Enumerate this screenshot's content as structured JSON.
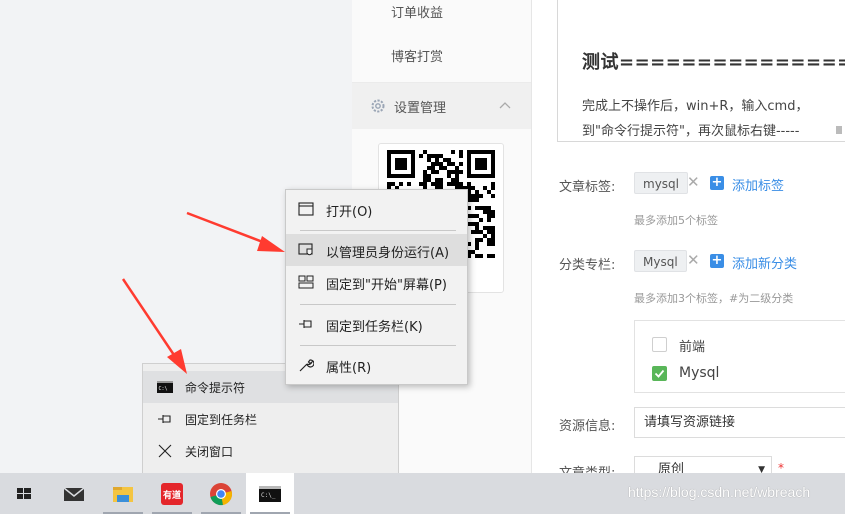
{
  "sidebar": {
    "items": [
      {
        "label": "订单收益"
      },
      {
        "label": "博客打赏"
      }
    ],
    "group_label": "设置管理"
  },
  "editor": {
    "title": "测试=================",
    "lines": [
      "完成上不操作后，win+R，输入cmd，",
      "到\"命令行提示符\"，再次鼠标右键-----"
    ]
  },
  "article_tags": {
    "label": "文章标签:",
    "tag": "mysql",
    "add": "添加标签",
    "hint": "最多添加5个标签"
  },
  "category": {
    "label": "分类专栏:",
    "tag": "Mysql",
    "add": "添加新分类",
    "hint": "最多添加3个标签，#为二级分类",
    "options": [
      {
        "label": "前端",
        "checked": false
      },
      {
        "label": "Mysql",
        "checked": true
      }
    ]
  },
  "resource": {
    "label": "资源信息:",
    "value": "请填写资源链接"
  },
  "article_type": {
    "label": "文章类型:",
    "value": "原创"
  },
  "context_menu": {
    "items": [
      {
        "label": "打开(O)",
        "icon": "window-icon"
      },
      {
        "label": "以管理员身份运行(A)",
        "icon": "shield-icon"
      },
      {
        "label": "固定到\"开始\"屏幕(P)",
        "icon": "start-pin-icon"
      },
      {
        "label": "固定到任务栏(K)",
        "icon": "pin-icon"
      },
      {
        "label": "属性(R)",
        "icon": "wrench-icon"
      }
    ]
  },
  "jump_list": {
    "items": [
      {
        "label": "命令提示符",
        "icon": "cmd-icon"
      },
      {
        "label": "固定到任务栏",
        "icon": "pin-icon"
      },
      {
        "label": "关闭窗口",
        "icon": "close-icon"
      }
    ]
  },
  "taskbar": {
    "apps": [
      "windows-start-icon",
      "mail-icon",
      "file-explorer-icon",
      "youdao-icon",
      "chrome-icon",
      "cmd-icon"
    ],
    "youdao_text": "有道"
  },
  "watermark": "https://blog.csdn.net/wbreach",
  "colors": {
    "accent": "#3a8ee6",
    "checked": "#59b659",
    "arrow": "#ff3b30",
    "required": "#e33333"
  }
}
